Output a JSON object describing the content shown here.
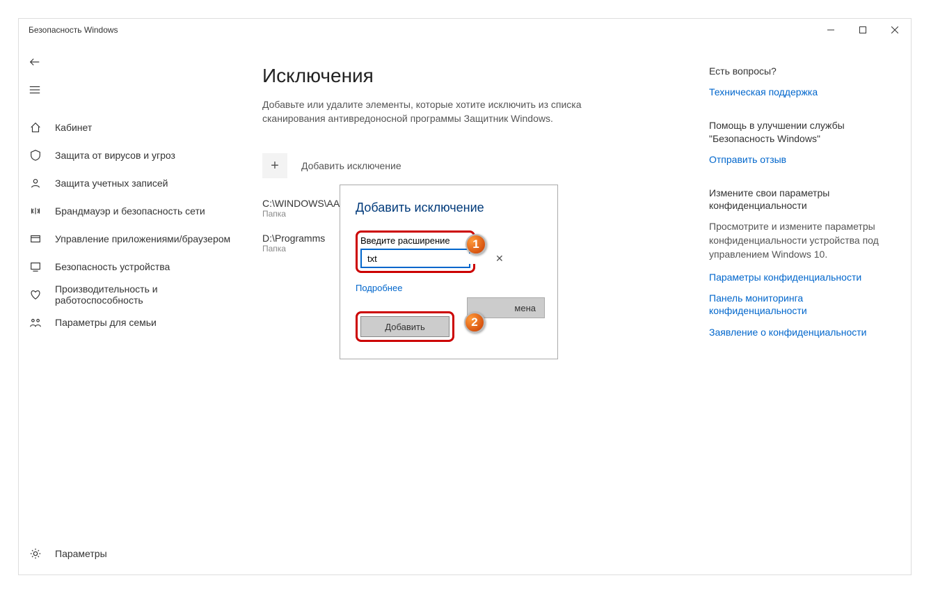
{
  "window": {
    "title": "Безопасность Windows"
  },
  "sidebar": {
    "items": [
      {
        "label": "Кабинет"
      },
      {
        "label": "Защита от вирусов и угроз"
      },
      {
        "label": "Защита учетных записей"
      },
      {
        "label": "Брандмауэр и безопасность сети"
      },
      {
        "label": "Управление приложениями/браузером"
      },
      {
        "label": "Безопасность устройства"
      },
      {
        "label": "Производительность и работоспособность"
      },
      {
        "label": "Параметры для семьи"
      }
    ],
    "settings": "Параметры"
  },
  "main": {
    "title": "Исключения",
    "description": "Добавьте или удалите элементы, которые хотите исключить из списка сканирования антивредоносной программы Защитник Windows.",
    "add_label": "Добавить исключение",
    "exclusions": [
      {
        "path": "C:\\WINDOWS\\AAct",
        "type": "Папка"
      },
      {
        "path": "D:\\Programms",
        "type": "Папка"
      }
    ]
  },
  "aside": {
    "block1": {
      "title": "Есть вопросы?",
      "link": "Техническая поддержка"
    },
    "block2": {
      "title": "Помощь в улучшении службы \"Безопасность Windows\"",
      "link": "Отправить отзыв"
    },
    "block3": {
      "title": "Измените свои параметры конфиденциальности",
      "text": "Просмотрите и измените параметры конфиденциальности устройства под управлением Windows 10.",
      "links": [
        "Параметры конфиденциальности",
        "Панель мониторинга конфиденциальности",
        "Заявление о конфиденциальности"
      ]
    }
  },
  "dialog": {
    "title": "Добавить исключение",
    "field_label": "Введите расширение",
    "field_value": "txt",
    "more": "Подробнее",
    "add": "Добавить",
    "cancel": "мена"
  },
  "callouts": {
    "one": "1",
    "two": "2"
  }
}
